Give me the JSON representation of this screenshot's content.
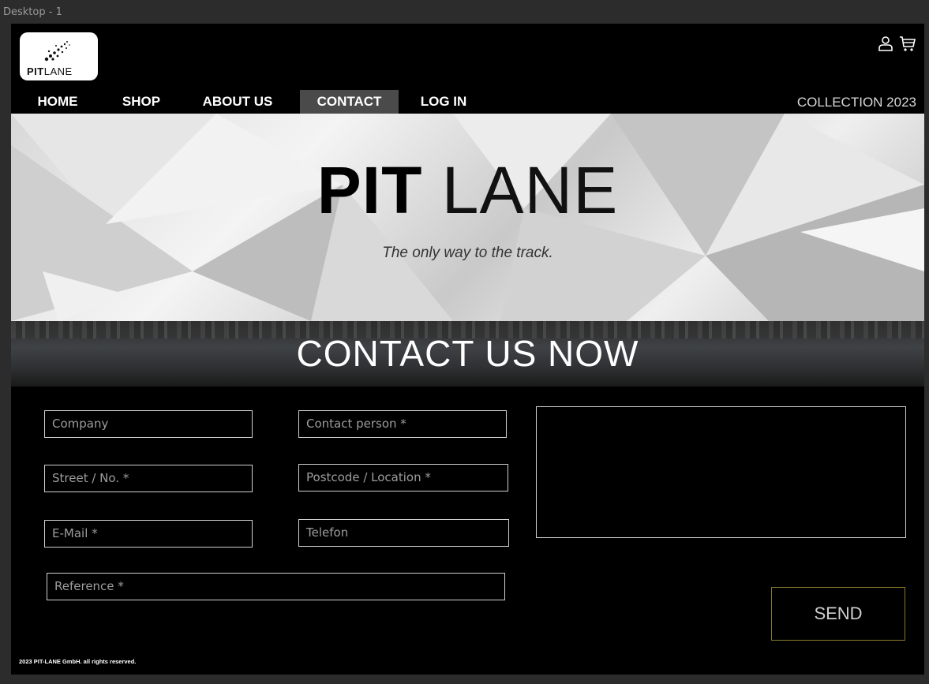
{
  "frame_label": "Desktop - 1",
  "logo": {
    "bold": "PIT",
    "light": "LANE"
  },
  "header_icons": [
    "user-icon",
    "cart-icon"
  ],
  "nav": {
    "items": [
      {
        "label": "HOME"
      },
      {
        "label": "SHOP"
      },
      {
        "label": "ABOUT US"
      },
      {
        "label": "CONTACT",
        "active": true
      },
      {
        "label": "LOG IN"
      }
    ],
    "collection": "COLLECTION 2023"
  },
  "hero": {
    "title_bold": "PIT",
    "title_light": " LANE",
    "subtitle": "The only way to the track."
  },
  "banner": {
    "title": "CONTACT US NOW"
  },
  "form": {
    "company": "Company",
    "contact_person": "Contact person *",
    "street": "Street / No. *",
    "postcode": "Postcode / Location *",
    "email": "E-Mail *",
    "telefon": "Telefon",
    "reference": "Reference *",
    "send": "SEND"
  },
  "footer": "2023 PIT-LANE GmbH. all rights reserved.",
  "colors": {
    "active_nav": "#4a4a4a",
    "send_border": "#8a7a2a"
  }
}
